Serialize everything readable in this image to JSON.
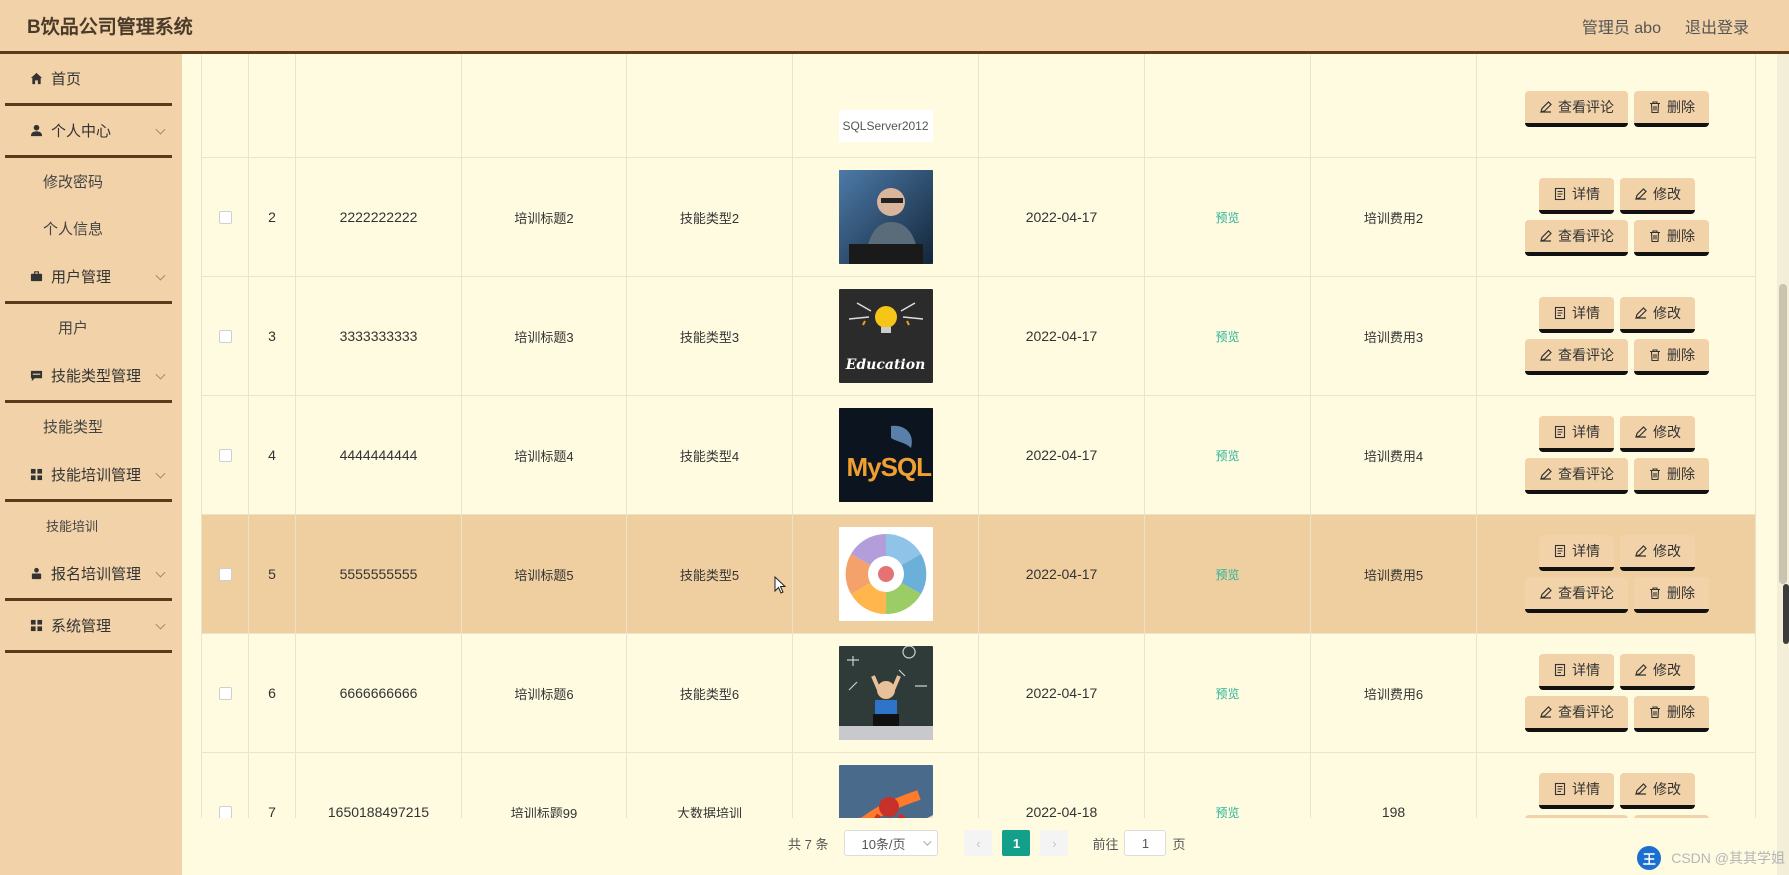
{
  "header": {
    "title": "B饮品公司管理系统",
    "admin_label": "管理员 abo",
    "logout_label": "退出登录"
  },
  "sidebar": {
    "items": [
      {
        "label": "首页",
        "icon": "home-icon"
      },
      {
        "label": "个人中心",
        "icon": "user-icon",
        "children": [
          "修改密码",
          "个人信息"
        ]
      },
      {
        "label": "用户管理",
        "icon": "briefcase-icon",
        "children": [
          "用户"
        ]
      },
      {
        "label": "技能类型管理",
        "icon": "message-icon",
        "children": [
          "技能类型"
        ]
      },
      {
        "label": "技能培训管理",
        "icon": "grid-icon",
        "children": [
          "技能培训"
        ]
      },
      {
        "label": "报名培训管理",
        "icon": "person-icon"
      },
      {
        "label": "系统管理",
        "icon": "grid-icon"
      }
    ]
  },
  "table": {
    "top_partial": {
      "image_text": "SQLServer2012",
      "ops": {
        "comment_label": "查看评论",
        "delete_label": "删除"
      }
    },
    "rows": [
      {
        "index": "2",
        "number": "2222222222",
        "title": "培训标题2",
        "type": "技能类型2",
        "date": "2022-04-17",
        "preview": "预览",
        "fee": "培训费用2",
        "image": "man-laptop"
      },
      {
        "index": "3",
        "number": "3333333333",
        "title": "培训标题3",
        "type": "技能类型3",
        "date": "2022-04-17",
        "preview": "预览",
        "fee": "培训费用3",
        "image": "education"
      },
      {
        "index": "4",
        "number": "4444444444",
        "title": "培训标题4",
        "type": "技能类型4",
        "date": "2022-04-17",
        "preview": "预览",
        "fee": "培训费用4",
        "image": "mysql"
      },
      {
        "index": "5",
        "number": "5555555555",
        "title": "培训标题5",
        "type": "技能类型5",
        "date": "2022-04-17",
        "preview": "预览",
        "fee": "培训费用5",
        "image": "java-wheel"
      },
      {
        "index": "6",
        "number": "6666666666",
        "title": "培训标题6",
        "type": "技能类型6",
        "date": "2022-04-17",
        "preview": "预览",
        "fee": "培训费用6",
        "image": "child-chalkboard"
      },
      {
        "index": "7",
        "number": "1650188497215",
        "title": "培训标题99",
        "type": "大数据培训",
        "date": "2022-04-18",
        "preview": "预览",
        "fee": "198",
        "image": "superhero"
      }
    ],
    "ops": {
      "detail_label": "详情",
      "edit_label": "修改",
      "comment_label": "查看评论",
      "delete_label": "删除"
    },
    "mysql_text": "MySQL",
    "education_text": "Education"
  },
  "pagination": {
    "total_label": "共 7 条",
    "page_size_label": "10条/页",
    "current_page": "1",
    "goto_label": "前往",
    "goto_value": "1",
    "page_suffix": "页",
    "prev_icon": "chevron-left-icon",
    "next_icon": "chevron-right-icon"
  },
  "tray": {
    "badge": "王",
    "watermark": "CSDN @其其学姐"
  },
  "colors": {
    "accent": "#f2d2a8",
    "highlight": "#efcfa0",
    "background": "#fffbe0",
    "link": "#2ab39a",
    "active_page": "#12a08a",
    "border_dark": "#5c3a1a"
  }
}
